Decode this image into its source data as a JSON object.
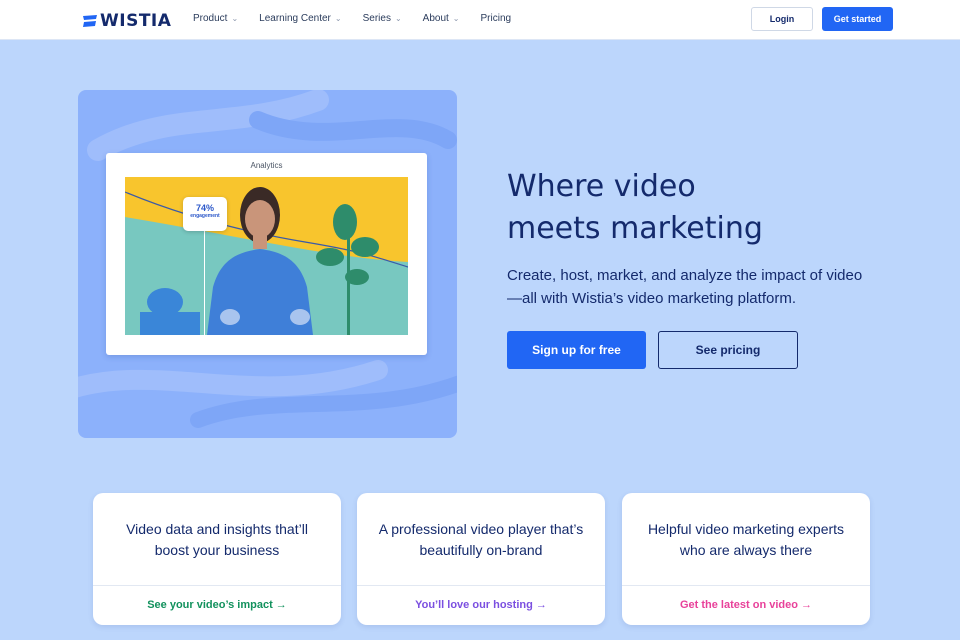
{
  "nav": {
    "brand": "WISTIA",
    "items": [
      {
        "label": "Product",
        "dropdown": true
      },
      {
        "label": "Learning Center",
        "dropdown": true
      },
      {
        "label": "Series",
        "dropdown": true
      },
      {
        "label": "About",
        "dropdown": true
      },
      {
        "label": "Pricing",
        "dropdown": false
      }
    ],
    "login": "Login",
    "get_started": "Get started"
  },
  "hero": {
    "card_title": "Analytics",
    "stat_value": "74%",
    "stat_label": "engagement",
    "title_line1": "Where video",
    "title_line2": "meets marketing",
    "subtitle_line1": "Create, host, market, and analyze the impact of video",
    "subtitle_line2": "—all with Wistia’s video marketing platform.",
    "primary_cta": "Sign up for free",
    "secondary_cta": "See pricing"
  },
  "features": [
    {
      "line1": "Video data and insights that’ll",
      "line2": "boost your business",
      "link": "See your video’s impact →",
      "link_color": "#12915d"
    },
    {
      "line1": "A professional video player that’s",
      "line2": "beautifully on-brand",
      "link": "You’ll love our hosting →",
      "link_color": "#7b4fe0"
    },
    {
      "line1": "Helpful video marketing experts",
      "line2": "who are always there",
      "link": "Get the latest on video →",
      "link_color": "#e8419a"
    }
  ],
  "colors": {
    "brand_blue": "#2166f4",
    "navy": "#142a6c",
    "page_bg": "#bcd6fc"
  }
}
